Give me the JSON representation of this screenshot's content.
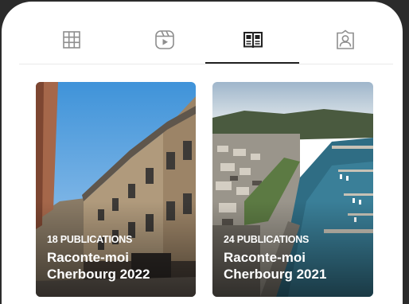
{
  "tabs": [
    {
      "icon": "grid-icon"
    },
    {
      "icon": "reels-icon"
    },
    {
      "icon": "guide-book-icon",
      "active": true
    },
    {
      "icon": "tagged-portrait-icon"
    }
  ],
  "guides": [
    {
      "count": "18 PUBLICATIONS",
      "title_line1": "Raconte-moi",
      "title_line2": "Cherbourg 2022"
    },
    {
      "count": "24 PUBLICATIONS",
      "title_line1": "Raconte-moi",
      "title_line2": "Cherbourg 2021"
    }
  ],
  "colors": {
    "active_tab": "#222222",
    "inactive_icon": "#8e8e8e",
    "frame": "#2b2b2b"
  }
}
